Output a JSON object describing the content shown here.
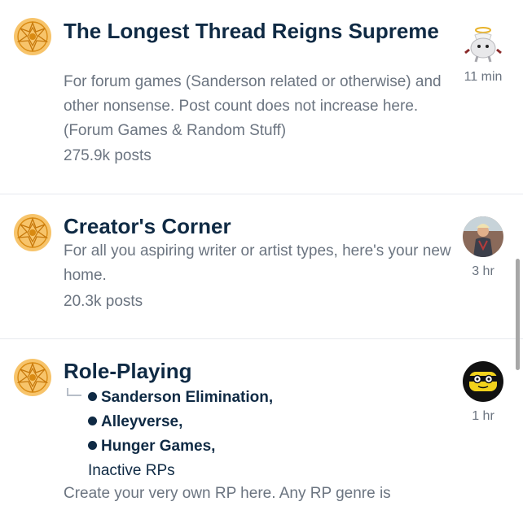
{
  "forums": [
    {
      "title": "The Longest Thread Reigns Supreme",
      "description": "For forum games (Sanderson related or otherwise) and other nonsense. Post count does not increase here. (Forum Games & Random Stuff)",
      "posts": "275.9k posts",
      "last_post_time": "11 min"
    },
    {
      "title": "Creator's Corner",
      "description": "For all you aspiring writer or artist types, here's your new home.",
      "posts": "20.3k posts",
      "last_post_time": "3 hr"
    },
    {
      "title": "Role-Playing",
      "subforums": [
        "Sanderson Elimination,",
        "Alleyverse,",
        "Hunger Games,"
      ],
      "inactive": "Inactive RPs",
      "description": "Create your very own RP here. Any RP genre is",
      "last_post_time": "1 hr"
    }
  ],
  "colors": {
    "title": "#0f2a44",
    "muted": "#6b7480",
    "icon": "#f2b14a",
    "divider": "#e6e9ee"
  },
  "icons": {
    "forum": "mandala-icon"
  }
}
